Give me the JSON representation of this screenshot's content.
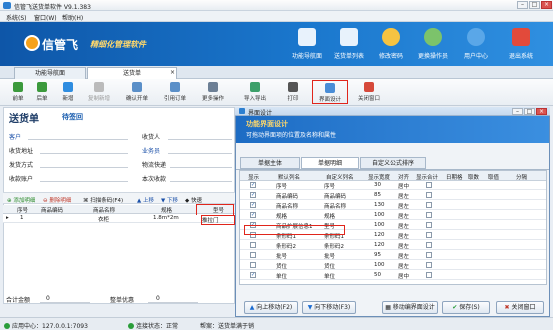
{
  "app": {
    "title": "信管飞送货单软件 V9.1.383"
  },
  "menu": [
    "系统(S)",
    "窗口(W)",
    "帮助(H)"
  ],
  "brand": {
    "name": "信管飞",
    "tagline": "精细化管理软件"
  },
  "topnav": [
    {
      "label": "功能导航面",
      "icon": "grid-icon",
      "color": "#e8f2fc"
    },
    {
      "label": "送货单列表",
      "icon": "list-icon",
      "color": "#e8f2fc"
    },
    {
      "label": "修改密码",
      "icon": "key-icon",
      "color": "#f6c342"
    },
    {
      "label": "更换操作员",
      "icon": "user-switch-icon",
      "color": "#7cc36b"
    },
    {
      "label": "用户中心",
      "icon": "globe-icon",
      "color": "#5aa7e8"
    },
    {
      "label": "退出系统",
      "icon": "power-icon",
      "color": "#e24a3b"
    }
  ],
  "doc_tabs": [
    "功能导航面",
    "送货单"
  ],
  "toolbar": [
    "前单",
    "后单",
    "新增",
    "复制新增",
    "确认开单",
    "引用订单",
    "更多操作",
    "导入导出",
    "打印",
    "界面设计",
    "关闭窗口"
  ],
  "document": {
    "title": "送货单",
    "status": "待签回",
    "fields_left": [
      "客户",
      "收货地址",
      "发货方式",
      "收款账户"
    ],
    "fields_right": [
      "收货人",
      "业务员",
      "物流快递",
      "本次收款"
    ]
  },
  "detail_toolbar": [
    "添加明细",
    "删除明细",
    "扫描条码(F4)",
    "上移",
    "下移",
    "快速"
  ],
  "detail_grid": {
    "headers": [
      "序号",
      "商品编码",
      "商品名称",
      "规格",
      "型号"
    ],
    "rows": [
      {
        "no": "1",
        "name": "衣柜",
        "spec": "1.8m*2m",
        "model": "推拉门"
      }
    ]
  },
  "footer": {
    "total_label": "合计金额",
    "total_value": "0",
    "discount_label": "整单优惠",
    "discount_value": "0"
  },
  "status": {
    "server": "应用中心：127.0.0.1:7093",
    "connection": "连接状态：正常",
    "tip": "帮案：送货单满于销"
  },
  "dialog": {
    "title": "界面设计",
    "header_title": "功能界面设计",
    "header_desc": "可拖动界面项的位置及名称和属性",
    "tabs": [
      "单据主体",
      "单据明细",
      "自定义公式排序"
    ],
    "columns": [
      "显示",
      "默认列名",
      "自定义列名",
      "显示宽度",
      "对齐",
      "显示合计",
      "日期格",
      "取数",
      "取值",
      "分隔"
    ],
    "rows": [
      {
        "show": true,
        "default": "序号",
        "custom": "序号",
        "width": "30",
        "align": "居中"
      },
      {
        "show": true,
        "default": "商品编码",
        "custom": "商品编码",
        "width": "85",
        "align": "居左"
      },
      {
        "show": true,
        "default": "商品名称",
        "custom": "商品名称",
        "width": "130",
        "align": "居左"
      },
      {
        "show": true,
        "default": "规格",
        "custom": "规格",
        "width": "100",
        "align": "居左"
      },
      {
        "show": true,
        "default": "商品扩展信息1",
        "custom": "型号",
        "width": "100",
        "align": "居左"
      },
      {
        "show": false,
        "default": "条形码1",
        "custom": "条形码1",
        "width": "120",
        "align": "居左"
      },
      {
        "show": false,
        "default": "条形码2",
        "custom": "条形码2",
        "width": "120",
        "align": "居左"
      },
      {
        "show": false,
        "default": "批号",
        "custom": "批号",
        "width": "95",
        "align": "居左"
      },
      {
        "show": false,
        "default": "货位",
        "custom": "货位",
        "width": "100",
        "align": "居左"
      },
      {
        "show": true,
        "default": "单位",
        "custom": "单位",
        "width": "50",
        "align": "居中"
      }
    ],
    "buttons": {
      "up": "向上移动(F2)",
      "down": "向下移动(F3)",
      "move_design": "移动编界面设计",
      "save": "保存(S)",
      "close": "关闭窗口"
    }
  }
}
